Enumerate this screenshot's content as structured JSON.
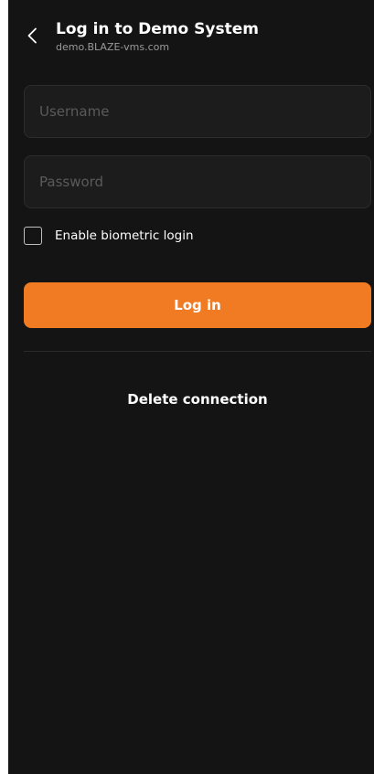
{
  "header": {
    "back_icon": "chevron-left-icon",
    "title": "Log in to Demo System",
    "subtitle": "demo.BLAZE-vms.com"
  },
  "form": {
    "username": {
      "value": "",
      "placeholder": "Username"
    },
    "password": {
      "value": "",
      "placeholder": "Password"
    },
    "biometric": {
      "label": "Enable biometric login",
      "checked": false
    },
    "login_label": "Log in",
    "delete_label": "Delete connection"
  },
  "colors": {
    "background": "#141414",
    "accent": "#f07b22",
    "field_background": "#1c1c1c",
    "subtitle": "#9a9a9a",
    "placeholder": "#5a5a5a"
  }
}
